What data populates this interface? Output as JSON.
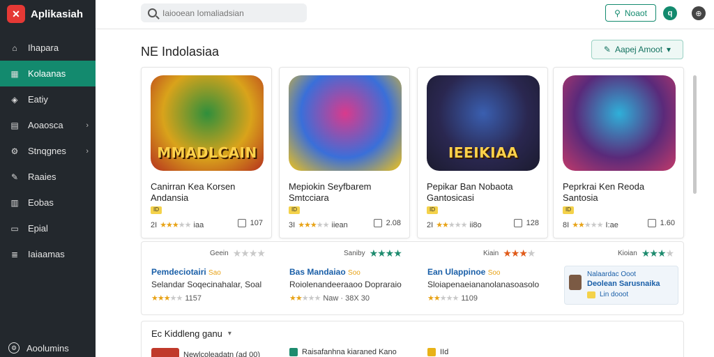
{
  "app": {
    "name": "Aplikasiah"
  },
  "sidebar": {
    "items": [
      {
        "label": "Ihapara",
        "icon": "home-icon",
        "active": false,
        "chevron": false
      },
      {
        "label": "Kolaanas",
        "icon": "grid-icon",
        "active": true,
        "chevron": false
      },
      {
        "label": "Eatiy",
        "icon": "shield-icon",
        "active": false,
        "chevron": false
      },
      {
        "label": "Aoaosca",
        "icon": "chart-icon",
        "active": false,
        "chevron": true
      },
      {
        "label": "Stnqgnes",
        "icon": "gear-icon",
        "active": false,
        "chevron": true
      },
      {
        "label": "Raaies",
        "icon": "pen-icon",
        "active": false,
        "chevron": false
      },
      {
        "label": "Eobas",
        "icon": "building-icon",
        "active": false,
        "chevron": false
      },
      {
        "label": "Epial",
        "icon": "document-icon",
        "active": false,
        "chevron": false
      },
      {
        "label": "Iaiaamas",
        "icon": "list-icon",
        "active": false,
        "chevron": false
      }
    ],
    "footer": {
      "label": "Aoolumins",
      "icon": "settings-circle-icon"
    }
  },
  "topbar": {
    "search_placeholder": "Iaiooean Iomaliadsian",
    "masuk_label": "Noaot",
    "settings_icon": "q",
    "globe_icon": "⊕"
  },
  "main": {
    "title": "NE Indolasiaa",
    "apply_label": "Aapej Amoot"
  },
  "cards": [
    {
      "image_label": "MMADLCAIN",
      "title": "Canirran Kea Korsen Andansia",
      "rating_prefix": "2I",
      "stars": 3,
      "rating_suffix": "iaa",
      "downloads": "107",
      "badge": "ID",
      "palette": [
        "#d9a31b",
        "#2f8f3c",
        "#b5311e"
      ]
    },
    {
      "image_label": "",
      "title": "Mepiokin Seyfbarem Smtcciara",
      "rating_prefix": "3I",
      "stars": 3,
      "rating_suffix": "iiean",
      "downloads": "2.08",
      "badge": "ID",
      "palette": [
        "#3a6fd9",
        "#d93a8c",
        "#f0c319"
      ]
    },
    {
      "image_label": "IEEIKIAA",
      "title": "Pepikar Ban Nobaota Gantosicasi",
      "rating_prefix": "2I",
      "stars": 2,
      "rating_suffix": "ii8o",
      "downloads": "128",
      "badge": "ID",
      "palette": [
        "#2a2750",
        "#3a5fb0",
        "#1b1b2e"
      ]
    },
    {
      "image_label": "",
      "title": "Peprkrai Ken Reoda Santosia",
      "rating_prefix": "8I",
      "stars": 2,
      "rating_suffix": "I:ae",
      "downloads": "1.60",
      "badge": "ID",
      "palette": [
        "#5a2a7a",
        "#2fb0d9",
        "#c23a6a"
      ]
    }
  ],
  "ratings_row": [
    {
      "label": "Geein",
      "stars": 0,
      "color": "grey"
    },
    {
      "label": "Saniby",
      "stars": 4,
      "color": "green"
    },
    {
      "label": "Kiain",
      "stars": 3,
      "color": "orange"
    },
    {
      "label": "Kioian",
      "stars": 3,
      "color": "green"
    }
  ],
  "list_items": [
    {
      "title": "Pemdeciotairi",
      "tag": "Sao",
      "subtitle": "Selandar Soqecinahalar, Soal",
      "stars": 3,
      "meta": "1157"
    },
    {
      "title": "Bas Mandaiao",
      "tag": "Soo",
      "subtitle": "Roiolenandeeraaoo Dopraraio",
      "stars": 2,
      "meta": "Naw · 38X 30"
    },
    {
      "title": "Ean Ulappinoe",
      "tag": "Soo",
      "subtitle": "Sloiapenaeiananolanasoasolo",
      "stars": 2,
      "meta": "1109"
    }
  ],
  "featured": {
    "line1": "Nalaardac Ooot",
    "line2": "Deolean Sarusnaika",
    "line3": "Lin dooot"
  },
  "bottom": {
    "header": "Ec Kiddleng ganu",
    "row": [
      {
        "text": "Newlcoleadatn (ad 00)"
      },
      {
        "text": "Raisafanhna kiaraned Kano"
      },
      {
        "text": "IId"
      }
    ]
  }
}
